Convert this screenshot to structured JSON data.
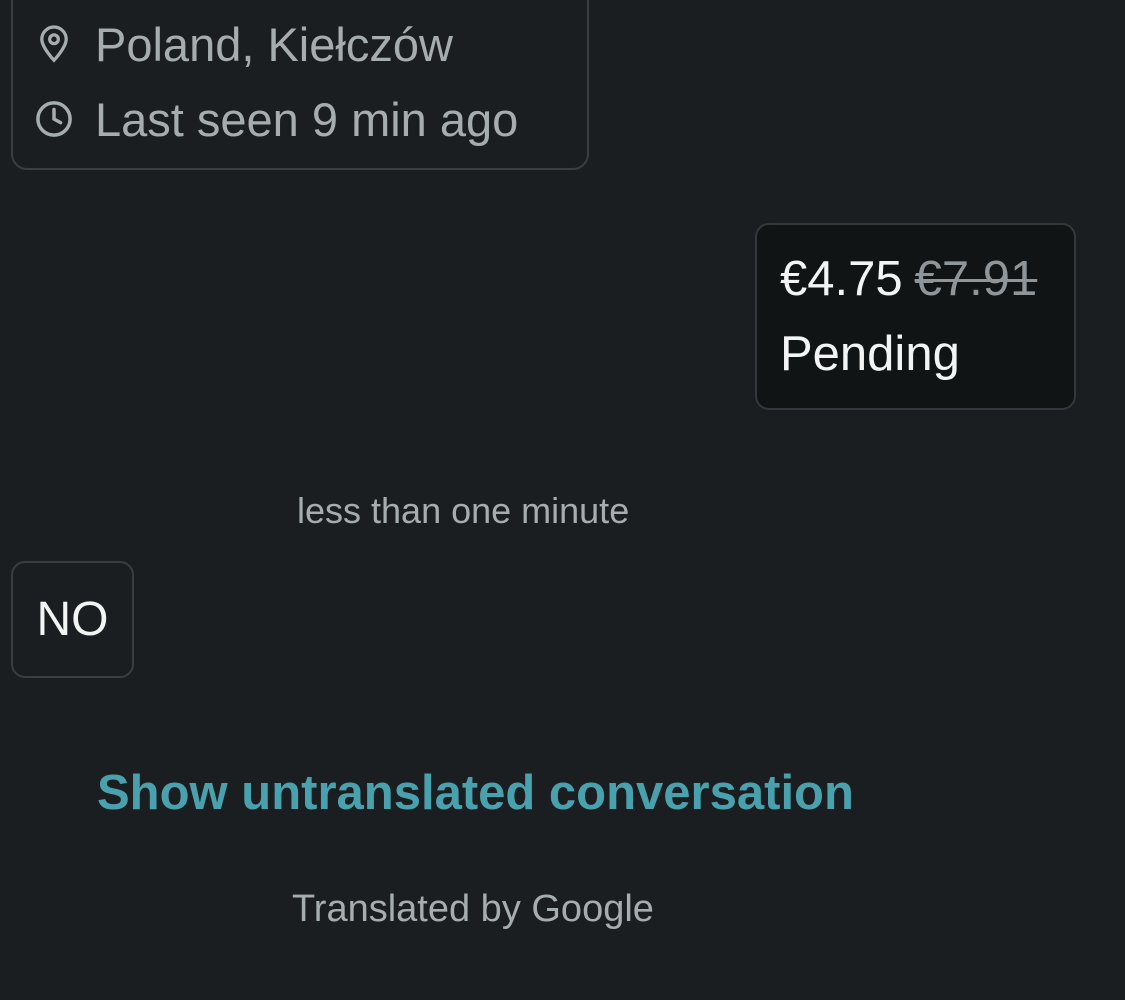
{
  "profile": {
    "location": "Poland, Kiełczów",
    "location_icon": "map-pin-icon",
    "last_seen": "Last seen 9 min ago",
    "last_seen_icon": "clock-icon"
  },
  "offer": {
    "new_price": "€4.75",
    "old_price": "€7.91",
    "status": "Pending"
  },
  "messages": {
    "timestamp": "less than one minute",
    "reply_text": "NO"
  },
  "translation": {
    "show_untranslated_label": "Show untranslated conversation",
    "translated_by": "Translated by Google"
  },
  "colors": {
    "background": "#1b1e20",
    "accent_link": "#4aa1ae",
    "muted_text": "#a6adaf",
    "primary_text": "#f3f5f5"
  }
}
